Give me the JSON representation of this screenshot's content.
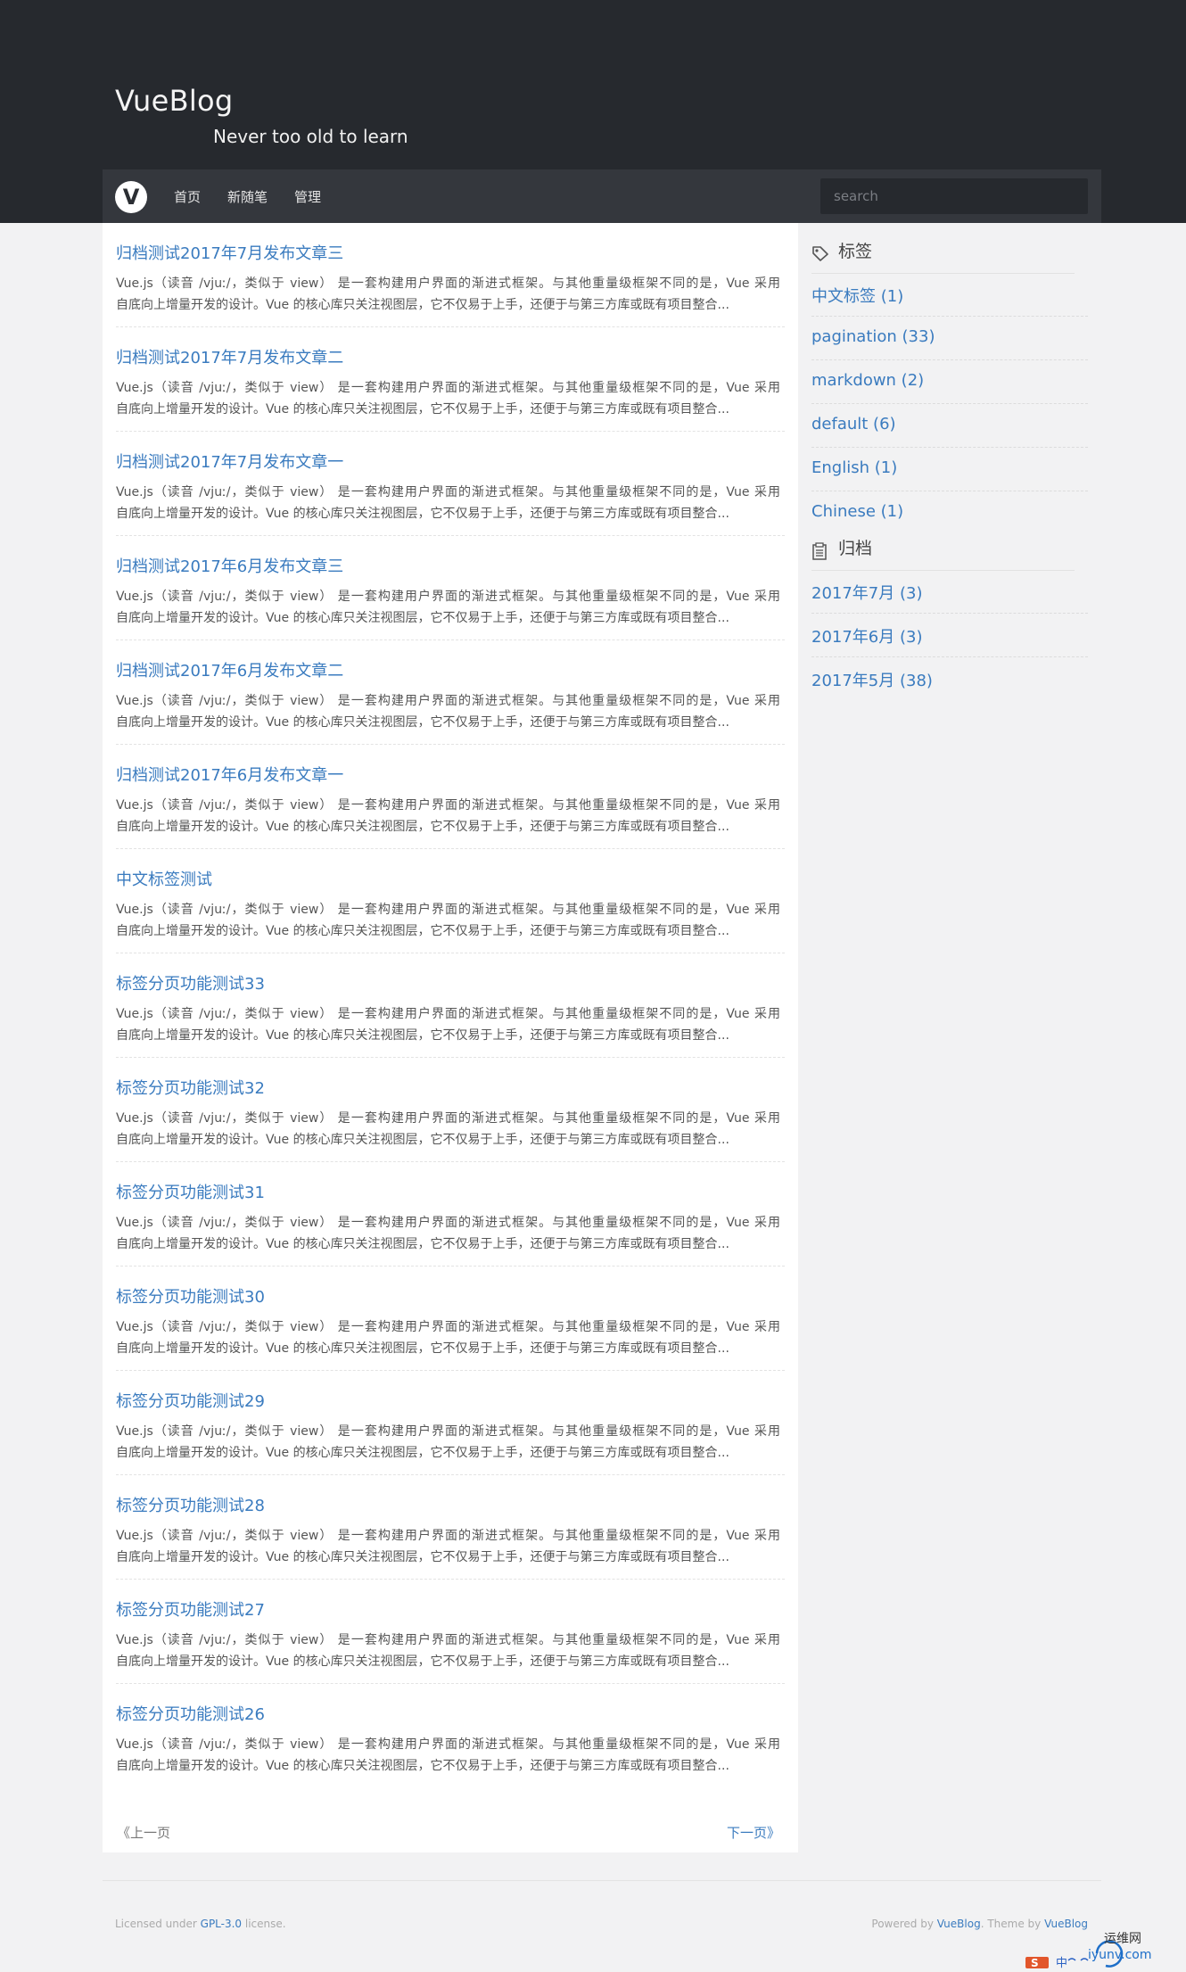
{
  "site": {
    "title": "VueBlog",
    "subtitle": "Never too old to learn",
    "logo_letter": "V"
  },
  "nav": {
    "items": [
      "首页",
      "新随笔",
      "管理"
    ],
    "search_placeholder": "search"
  },
  "posts": [
    {
      "title": "归档测试2017年7月发布文章三"
    },
    {
      "title": "归档测试2017年7月发布文章二"
    },
    {
      "title": "归档测试2017年7月发布文章一"
    },
    {
      "title": "归档测试2017年6月发布文章三"
    },
    {
      "title": "归档测试2017年6月发布文章二"
    },
    {
      "title": "归档测试2017年6月发布文章一"
    },
    {
      "title": "中文标签测试"
    },
    {
      "title": "标签分页功能测试33"
    },
    {
      "title": "标签分页功能测试32"
    },
    {
      "title": "标签分页功能测试31"
    },
    {
      "title": "标签分页功能测试30"
    },
    {
      "title": "标签分页功能测试29"
    },
    {
      "title": "标签分页功能测试28"
    },
    {
      "title": "标签分页功能测试27"
    },
    {
      "title": "标签分页功能测试26"
    }
  ],
  "excerpt": {
    "line1": "Vue.js（读音 /vjuː/，类似于 view） 是一套构建用户界面的渐进式框架。与其他重量级框架不同的是，Vue 采用",
    "line2": "自底向上增量开发的设计。Vue 的核心库只关注视图层，它不仅易于上手，还便于与第三方库或既有项目整合..."
  },
  "pager": {
    "prev": "《上一页",
    "next": "下一页》"
  },
  "sidebar": {
    "tags_title": "标签",
    "tags": [
      "中文标签 (1)",
      "pagination (33)",
      "markdown (2)",
      "default (6)",
      "English (1)",
      "Chinese (1)"
    ],
    "archive_title": "归档",
    "archives": [
      "2017年7月 (3)",
      "2017年6月 (3)",
      "2017年5月 (38)"
    ]
  },
  "footer": {
    "licensed_prefix": "Licensed under ",
    "license_link": "GPL-3.0",
    "licensed_suffix": " license.",
    "powered_prefix": "Powered by ",
    "powered_link": "VueBlog",
    "theme_prefix": ". Theme by ",
    "theme_link": "VueBlog"
  },
  "watermark": {
    "site_name": "运维网",
    "site_url": "iyunv.com",
    "ime_text": "中"
  },
  "colors": {
    "header_bg": "#26292e",
    "navbar_bg": "#34373d",
    "link": "#3a7bbf",
    "page_bg": "#f2f2f3"
  }
}
